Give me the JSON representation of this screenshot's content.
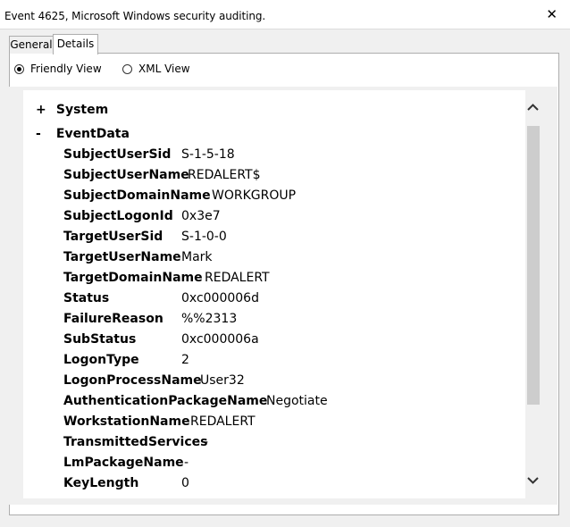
{
  "window": {
    "title": "Event 4625, Microsoft Windows security auditing.",
    "close_label": "✕"
  },
  "tabs": [
    {
      "label": "General",
      "active": false
    },
    {
      "label": "Details",
      "active": true
    }
  ],
  "view_options": {
    "selected": "Friendly View",
    "options": [
      "Friendly View",
      "XML View"
    ]
  },
  "tree": {
    "system": {
      "sign": "+",
      "label": "System"
    },
    "eventdata": {
      "sign": "-",
      "label": "EventData"
    },
    "fields": [
      {
        "key": "SubjectUserSid",
        "value": "S-1-5-18"
      },
      {
        "key": "SubjectUserName",
        "value": "REDALERT$"
      },
      {
        "key": "SubjectDomainName",
        "value": "WORKGROUP"
      },
      {
        "key": "SubjectLogonId",
        "value": "0x3e7"
      },
      {
        "key": "TargetUserSid",
        "value": "S-1-0-0"
      },
      {
        "key": "TargetUserName",
        "value": "Mark"
      },
      {
        "key": "TargetDomainName",
        "value": "REDALERT"
      },
      {
        "key": "Status",
        "value": "0xc000006d"
      },
      {
        "key": "FailureReason",
        "value": "%%2313"
      },
      {
        "key": "SubStatus",
        "value": "0xc000006a"
      },
      {
        "key": "LogonType",
        "value": "2"
      },
      {
        "key": "LogonProcessName",
        "value": "User32"
      },
      {
        "key": "AuthenticationPackageName",
        "value": "Negotiate"
      },
      {
        "key": "WorkstationName",
        "value": "REDALERT"
      },
      {
        "key": "TransmittedServices",
        "value": "-"
      },
      {
        "key": "LmPackageName",
        "value": "-"
      },
      {
        "key": "KeyLength",
        "value": "0"
      }
    ]
  },
  "scrollbar": {
    "up_icon": "chevron-up-icon",
    "down_icon": "chevron-down-icon"
  }
}
